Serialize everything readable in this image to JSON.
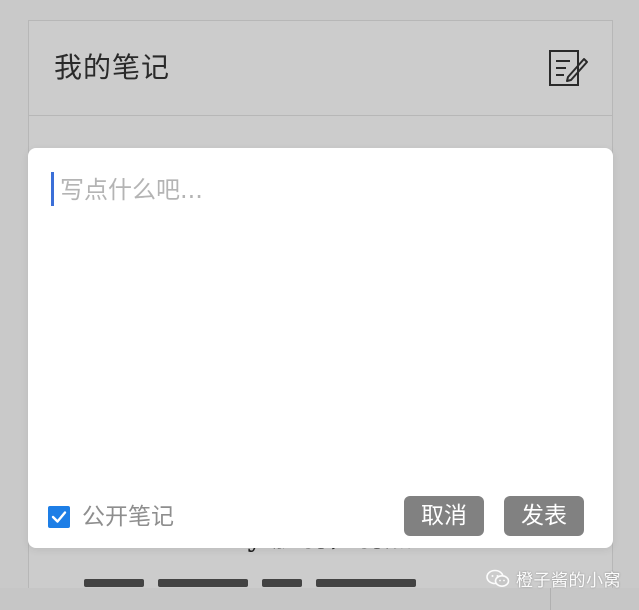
{
  "header": {
    "title": "我的笔记",
    "compose_icon": "compose-edit-icon"
  },
  "background": {
    "text_line": "vulnerability 脆弱，弱点"
  },
  "dialog": {
    "placeholder": "写点什么吧...",
    "value": "",
    "public_checkbox": {
      "label": "公开笔记",
      "checked": true
    },
    "cancel_label": "取消",
    "publish_label": "发表"
  },
  "watermark": {
    "text": "橙子酱的小窝",
    "icon": "wechat-icon"
  },
  "colors": {
    "accent": "#1d7ee6",
    "caret": "#3b6fd8",
    "button": "#818181",
    "overlay": "#c9c9c9"
  }
}
